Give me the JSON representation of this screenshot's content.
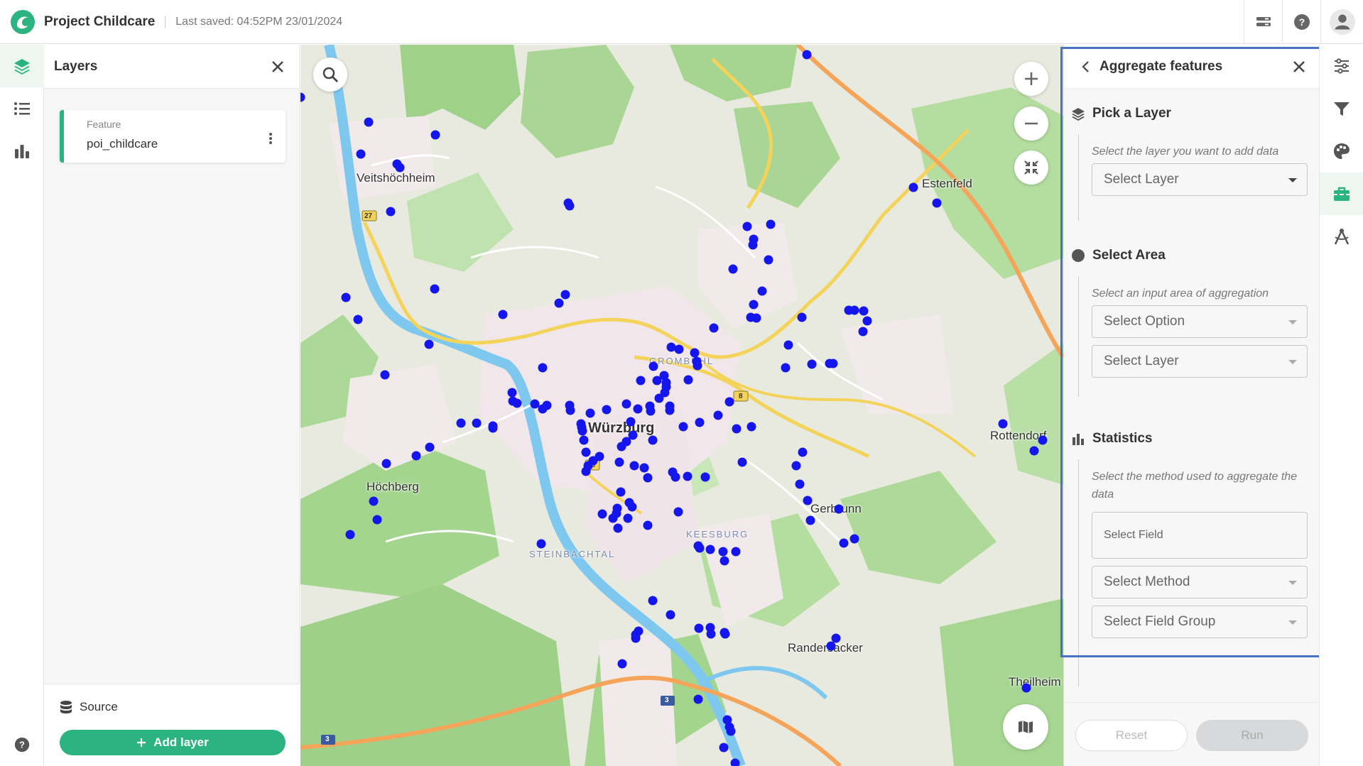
{
  "header": {
    "project_title": "Project Childcare",
    "last_saved": "Last saved: 04:52PM 23/01/2024",
    "icons": [
      "stack-icon",
      "help-icon",
      "user-avatar-icon"
    ]
  },
  "left_rail": {
    "items": [
      "layers-icon",
      "list-icon",
      "bar-chart-icon"
    ],
    "bottom": "help-icon"
  },
  "layers_panel": {
    "title": "Layers",
    "layer": {
      "type": "Feature",
      "name": "poi_childcare"
    },
    "source_label": "Source",
    "add_layer_label": "Add layer"
  },
  "map": {
    "labels": {
      "veitshoechheim": "Veitshöchheim",
      "estenfeld": "Estenfeld",
      "wuerzburg": "Würzburg",
      "grombuehl": "GROMBÜHL",
      "hoechberg": "Höchberg",
      "rottendorf": "Rottendorf",
      "gerbrunn": "Gerbrunn",
      "keesburg": "KEESBURG",
      "steinbachtal": "STEINBACHTAL",
      "randersacker": "Randersacker",
      "theilheim": "Theilheim"
    },
    "road_shields": [
      "27",
      "8",
      "19",
      "3",
      "3"
    ],
    "point_color": "#1515ee",
    "controls": [
      "search-icon",
      "zoom-in-icon",
      "zoom-out-icon",
      "fit-extent-icon",
      "basemap-icon"
    ]
  },
  "aggregate": {
    "title": "Aggregate features",
    "pick_layer": {
      "title": "Pick a Layer",
      "hint": "Select the layer you want to add data",
      "select": "Select Layer"
    },
    "select_area": {
      "title": "Select Area",
      "hint": "Select an input area of aggregation",
      "option": "Select Option",
      "layer": "Select Layer"
    },
    "statistics": {
      "title": "Statistics",
      "hint": "Select the method used to aggregate the data",
      "field": "Select Field",
      "method": "Select Method",
      "field_group": "Select Field Group"
    },
    "reset_label": "Reset",
    "run_label": "Run"
  },
  "right_rail": {
    "items": [
      "sliders-icon",
      "filter-icon",
      "palette-icon",
      "toolbox-icon",
      "compass-icon"
    ]
  },
  "colors": {
    "accent": "#2bb381",
    "highlight_frame": "#4a72c4"
  }
}
